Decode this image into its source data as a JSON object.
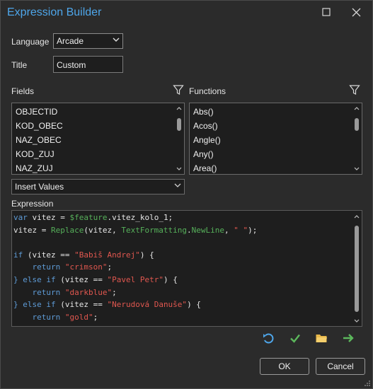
{
  "window": {
    "title": "Expression Builder"
  },
  "language": {
    "label": "Language",
    "value": "Arcade"
  },
  "title_field": {
    "label": "Title",
    "value": "Custom"
  },
  "fields": {
    "label": "Fields",
    "items": [
      "OBJECTID",
      "KOD_OBEC",
      "NAZ_OBEC",
      "KOD_ZUJ",
      "NAZ_ZUJ"
    ]
  },
  "functions": {
    "label": "Functions",
    "items": [
      "Abs()",
      "Acos()",
      "Angle()",
      "Any()",
      "Area()"
    ]
  },
  "insert_values": {
    "value": "Insert Values"
  },
  "expression": {
    "label": "Expression",
    "lines": [
      [
        [
          "kw",
          "var"
        ],
        [
          "tb",
          " vitez = "
        ],
        [
          "fe",
          "$feature"
        ],
        [
          "tb",
          ".vitez_kolo_1;"
        ]
      ],
      [
        [
          "tb",
          "vitez = "
        ],
        [
          "fe",
          "Replace"
        ],
        [
          "tb",
          "(vitez, "
        ],
        [
          "fe",
          "TextFormatting"
        ],
        [
          "tb",
          "."
        ],
        [
          "fe",
          "NewLine"
        ],
        [
          "tb",
          ", "
        ],
        [
          "st",
          "\" \""
        ],
        [
          "tb",
          ");"
        ]
      ],
      [],
      [
        [
          "kw",
          "if"
        ],
        [
          "tb",
          " (vitez == "
        ],
        [
          "st",
          "\"Babiš Andrej\""
        ],
        [
          "tb",
          ") {"
        ]
      ],
      [
        [
          "tb",
          "    "
        ],
        [
          "kw",
          "return"
        ],
        [
          "tb",
          " "
        ],
        [
          "st",
          "\"crimson\""
        ],
        [
          "tb",
          ";"
        ]
      ],
      [
        [
          "kw",
          "}"
        ],
        [
          "tb",
          " "
        ],
        [
          "kw",
          "else if"
        ],
        [
          "tb",
          " (vitez == "
        ],
        [
          "st",
          "\"Pavel Petr\""
        ],
        [
          "tb",
          ") {"
        ]
      ],
      [
        [
          "tb",
          "    "
        ],
        [
          "kw",
          "return"
        ],
        [
          "tb",
          " "
        ],
        [
          "st",
          "\"darkblue\""
        ],
        [
          "tb",
          ";"
        ]
      ],
      [
        [
          "kw",
          "}"
        ],
        [
          "tb",
          " "
        ],
        [
          "kw",
          "else if"
        ],
        [
          "tb",
          " (vitez == "
        ],
        [
          "st",
          "\"Nerudová Danuše\""
        ],
        [
          "tb",
          ") {"
        ]
      ],
      [
        [
          "tb",
          "    "
        ],
        [
          "kw",
          "return"
        ],
        [
          "tb",
          " "
        ],
        [
          "st",
          "\"gold\""
        ],
        [
          "tb",
          ";"
        ]
      ],
      [
        [
          "kw",
          "}"
        ]
      ]
    ]
  },
  "buttons": {
    "ok": "OK",
    "cancel": "Cancel"
  },
  "icons": {
    "undo": "undo-icon",
    "verify": "check-icon",
    "open": "folder-icon",
    "next": "arrow-right-icon",
    "colors": {
      "accent": "#4ea6ea",
      "check": "#5cb85c",
      "folder": "#e8b84a",
      "arrow": "#5cb85c"
    }
  }
}
